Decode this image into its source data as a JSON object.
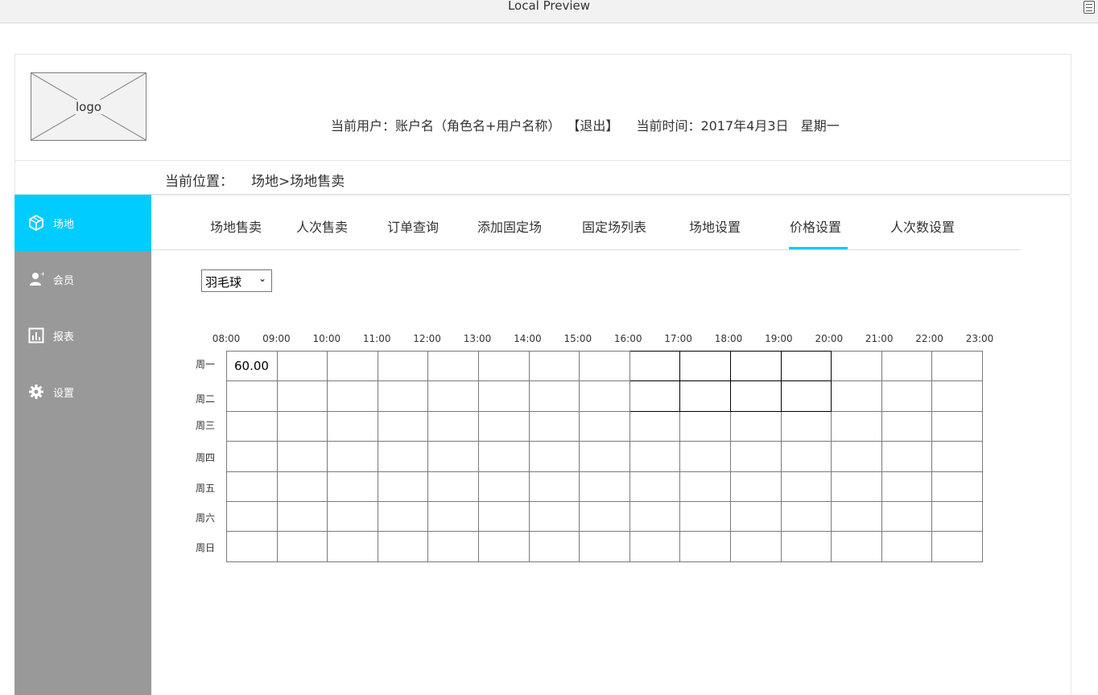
{
  "window": {
    "title": "Local Preview"
  },
  "header": {
    "logo_text": "logo",
    "current_user_label": "当前用户：账户名（角色名+用户名称）",
    "logout_label": "【退出】",
    "current_time_label": "当前时间：2017年4月3日   星期一"
  },
  "breadcrumb": {
    "label": "当前位置：",
    "path": "场地>场地售卖"
  },
  "sidebar": {
    "items": [
      {
        "label": "场地",
        "icon": "cube-icon",
        "active": true
      },
      {
        "label": "会员",
        "icon": "member-icon",
        "active": false
      },
      {
        "label": "报表",
        "icon": "chart-icon",
        "active": false
      },
      {
        "label": "设置",
        "icon": "gear-icon",
        "active": false
      }
    ]
  },
  "tabs": [
    {
      "label": "场地售卖",
      "active": false
    },
    {
      "label": "人次售卖",
      "active": false
    },
    {
      "label": "订单查询",
      "active": false
    },
    {
      "label": "添加固定场",
      "active": false
    },
    {
      "label": "固定场列表",
      "active": false
    },
    {
      "label": "场地设置",
      "active": false
    },
    {
      "label": "价格设置",
      "active": true
    },
    {
      "label": "人次数设置",
      "active": false
    }
  ],
  "sport_select": {
    "value": "羽毛球"
  },
  "price_grid": {
    "times": [
      "08:00",
      "09:00",
      "10:00",
      "11:00",
      "12:00",
      "13:00",
      "14:00",
      "15:00",
      "16:00",
      "17:00",
      "18:00",
      "19:00",
      "20:00",
      "21:00",
      "22:00",
      "23:00"
    ],
    "days": [
      "周一",
      "周二",
      "周三",
      "周四",
      "周五",
      "周六",
      "周日"
    ],
    "cells": [
      [
        "60.00",
        "",
        "",
        "",
        "",
        "",
        "",
        "",
        "",
        "",
        "",
        "",
        "",
        "",
        "",
        ""
      ],
      [
        "",
        "",
        "",
        "",
        "",
        "",
        "",
        "",
        "",
        "",
        "",
        "",
        "",
        "",
        "",
        ""
      ],
      [
        "",
        "",
        "",
        "",
        "",
        "",
        "",
        "",
        "",
        "",
        "",
        "",
        "",
        "",
        "",
        ""
      ],
      [
        "",
        "",
        "",
        "",
        "",
        "",
        "",
        "",
        "",
        "",
        "",
        "",
        "",
        "",
        "",
        ""
      ],
      [
        "",
        "",
        "",
        "",
        "",
        "",
        "",
        "",
        "",
        "",
        "",
        "",
        "",
        "",
        "",
        ""
      ],
      [
        "",
        "",
        "",
        "",
        "",
        "",
        "",
        "",
        "",
        "",
        "",
        "",
        "",
        "",
        "",
        ""
      ],
      [
        "",
        "",
        "",
        "",
        "",
        "",
        "",
        "",
        "",
        "",
        "",
        "",
        "",
        "",
        "",
        ""
      ]
    ]
  },
  "colors": {
    "accent": "#00ccff",
    "sidebar_bg": "#999999",
    "grid_border": "#7a7a7a"
  }
}
